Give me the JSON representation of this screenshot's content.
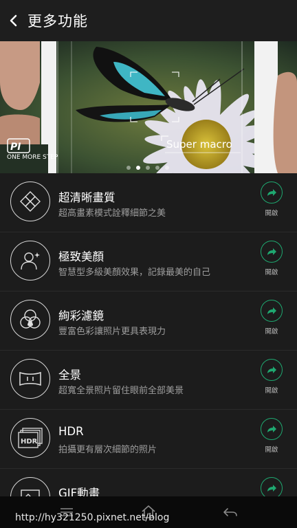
{
  "header": {
    "title": "更多功能"
  },
  "banner": {
    "caption": "Super macro",
    "logo_text": "ONE MORE STEP",
    "page_dots": 5,
    "active_dot": 2
  },
  "features": [
    {
      "title": "超清晰畫質",
      "subtitle": "超高畫素模式詮釋細節之美",
      "action": "開啟",
      "icon": "diamond-grid-icon"
    },
    {
      "title": "極致美顏",
      "subtitle": "智慧型多級美顏效果，記錄最美的自己",
      "action": "開啟",
      "icon": "beauty-face-icon"
    },
    {
      "title": "絢彩濾鏡",
      "subtitle": "豐富色彩讓照片更具表現力",
      "action": "開啟",
      "icon": "color-filter-icon"
    },
    {
      "title": "全景",
      "subtitle": "超寬全景照片留住眼前全部美景",
      "action": "開啟",
      "icon": "panorama-icon"
    },
    {
      "title": "HDR",
      "subtitle": "拍攝更有層次細節的照片",
      "action": "開啟",
      "icon": "hdr-icon"
    },
    {
      "title": "GIF動畫",
      "subtitle": "",
      "action": "",
      "icon": "gif-icon"
    }
  ],
  "watermark": "http://hy321250.pixnet.net/blog",
  "colors": {
    "accent": "#1fa870",
    "background": "#1c1c1c",
    "header": "#1e1e1e"
  }
}
